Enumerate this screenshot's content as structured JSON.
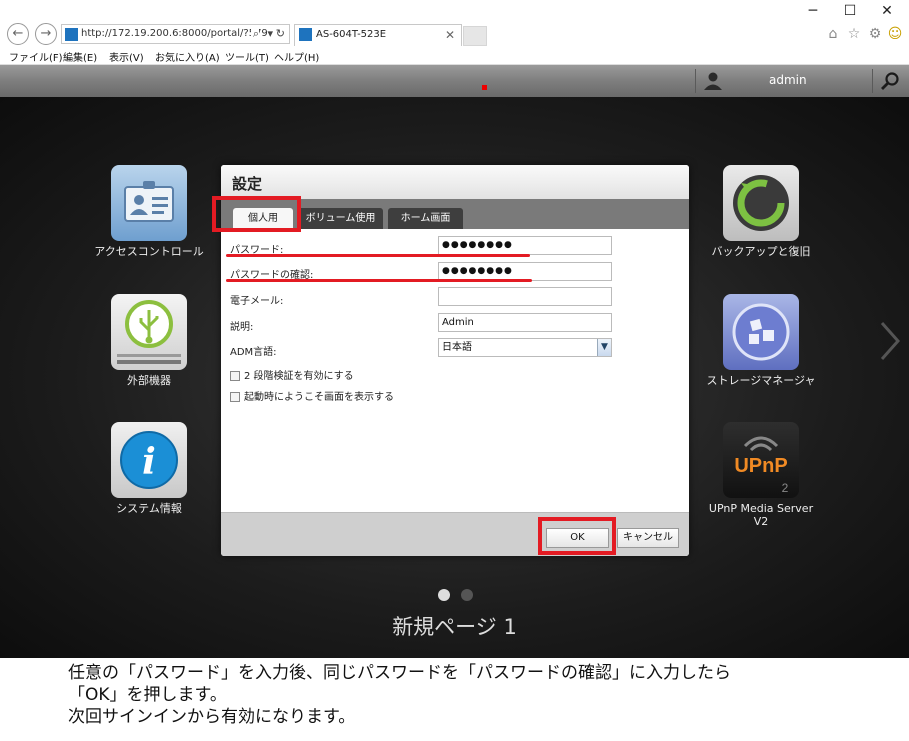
{
  "browser": {
    "address": "http://172.19.200.6:8000/portal/?579",
    "tab_title": "AS-604T-523E",
    "icons": [
      "back-icon",
      "forward-icon",
      "search-icon",
      "refresh-icon",
      "close-icon",
      "home-icon",
      "star-icon",
      "gear-icon",
      "smiley-icon",
      "minimize-icon",
      "maximize-icon",
      "close-window-icon"
    ]
  },
  "menubar": [
    "ファイル(F)",
    "編集(E)",
    "表示(V)",
    "お気に入り(A)",
    "ツール(T)",
    "ヘルプ(H)"
  ],
  "adm": {
    "username": "admin"
  },
  "apps_left": [
    {
      "label": "アクセスコントロール"
    },
    {
      "label": "外部機器"
    },
    {
      "label": "システム情報"
    }
  ],
  "apps_right": [
    {
      "label": "バックアップと復旧"
    },
    {
      "label": "ストレージマネージャ"
    },
    {
      "label": "UPnP Media Server V2",
      "tile_text": "UPnP",
      "tile_sub": "2"
    }
  ],
  "page_title": "新規ページ 1",
  "dialog": {
    "title": "設定",
    "tabs": [
      "個人用",
      "ボリューム使用",
      "ホーム画面"
    ],
    "fields": {
      "password_label": "パスワード:",
      "password_value": "●●●●●●●●",
      "confirm_label": "パスワードの確認:",
      "confirm_value": "●●●●●●●●",
      "email_label": "電子メール:",
      "email_value": "",
      "desc_label": "説明:",
      "desc_value": "Admin",
      "lang_label": "ADM言語:",
      "lang_value": "日本語"
    },
    "checkboxes": [
      "2 段階検証を有効にする",
      "起動時にようこそ画面を表示する"
    ],
    "ok_label": "OK",
    "cancel_label": "キャンセル"
  },
  "caption": {
    "line1": "任意の「パスワード」を入力後、同じパスワードを「パスワードの確認」に入力したら",
    "line2": "「OK」を押します。",
    "line3": "次回サインインから有効になります。"
  },
  "colors": {
    "annotation_red": "#e31b23",
    "favicon_blue": "#1e73be"
  }
}
